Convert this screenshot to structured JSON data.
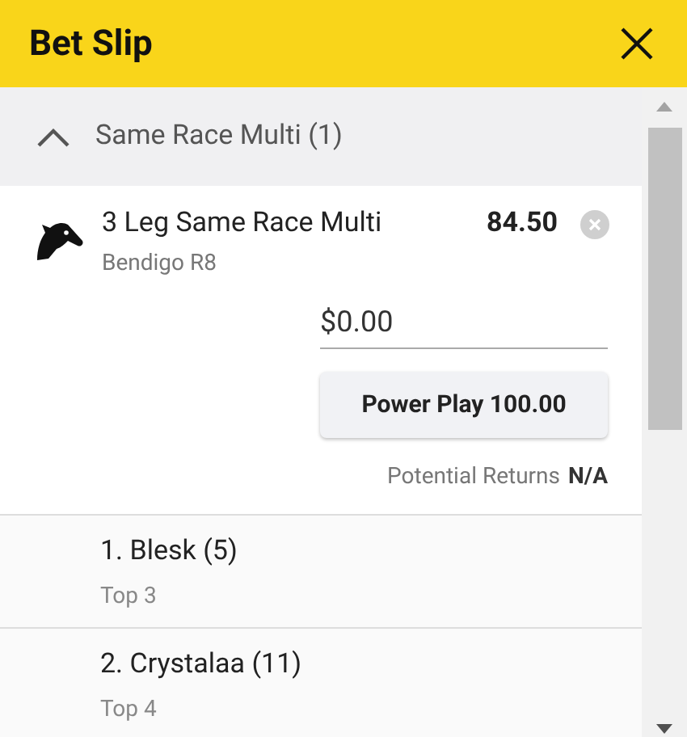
{
  "header": {
    "title": "Bet Slip"
  },
  "section": {
    "title": "Same Race Multi (1)",
    "expanded": true
  },
  "bet": {
    "title": "3 Leg Same Race Multi",
    "odds": "84.50",
    "meeting": "Bendigo R8",
    "stake": "$0.00",
    "power_play": "Power Play 100.00",
    "returns_label": "Potential Returns",
    "returns_value": "N/A"
  },
  "legs": [
    {
      "runner": "1. Blesk (5)",
      "market": "Top 3"
    },
    {
      "runner": "2. Crystalaa (11)",
      "market": "Top 4"
    }
  ]
}
